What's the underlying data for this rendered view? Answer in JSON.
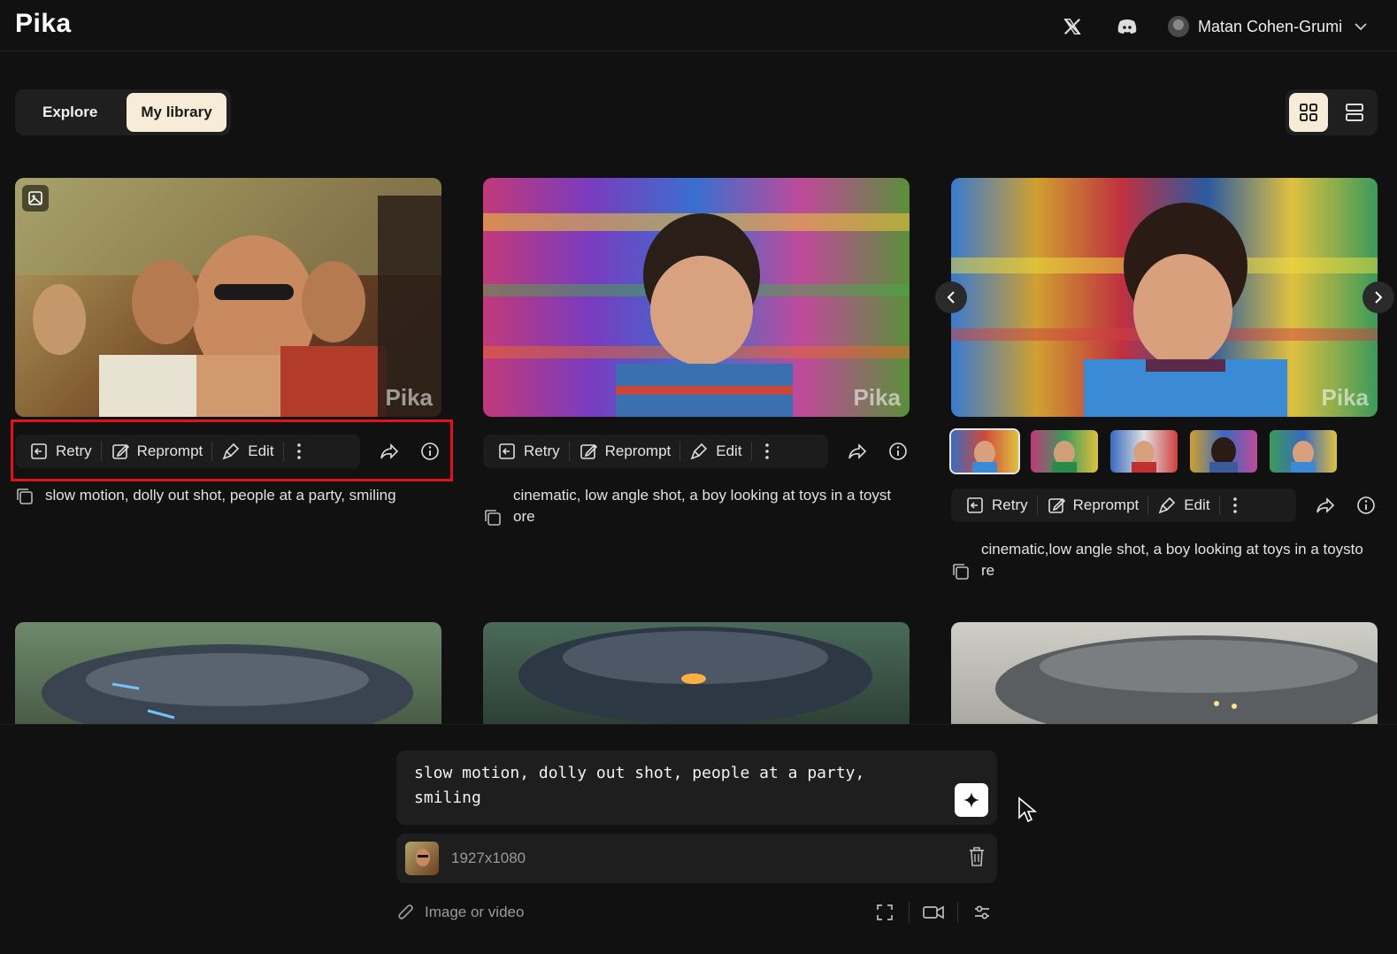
{
  "header": {
    "logo": "Pika",
    "user_name": "Matan Cohen-Grumi",
    "icons": [
      "x-logo-icon",
      "discord-icon",
      "user-avatar",
      "chevron-down-icon"
    ]
  },
  "tabs": [
    {
      "label": "Explore",
      "active": false
    },
    {
      "label": "My library",
      "active": true
    }
  ],
  "view_modes": [
    {
      "name": "grid-view-icon",
      "active": true
    },
    {
      "name": "list-view-icon",
      "active": false
    }
  ],
  "actions": {
    "retry": "Retry",
    "reprompt": "Reprompt",
    "edit": "Edit"
  },
  "cards": [
    {
      "watermark": "Pika",
      "prompt": "slow motion, dolly out shot, people at a party, smiling",
      "has_image_badge": true
    },
    {
      "watermark": "Pika",
      "prompt": "cinematic, low angle shot, a boy looking at toys in a toyst\nore"
    },
    {
      "watermark": "Pika",
      "prompt": "cinematic,low angle shot, a boy looking at toys in a toysto\nre",
      "variations": 5,
      "selected_variation": 1
    }
  ],
  "composer": {
    "text": "slow motion, dolly out shot, people at a party,\nsmiling",
    "attachment_dimensions": "1927x1080",
    "attach_placeholder": "Image or video"
  },
  "colors": {
    "background": "#111111",
    "active_tab": "#f6ecd7",
    "highlight_box": "#e0121a"
  }
}
